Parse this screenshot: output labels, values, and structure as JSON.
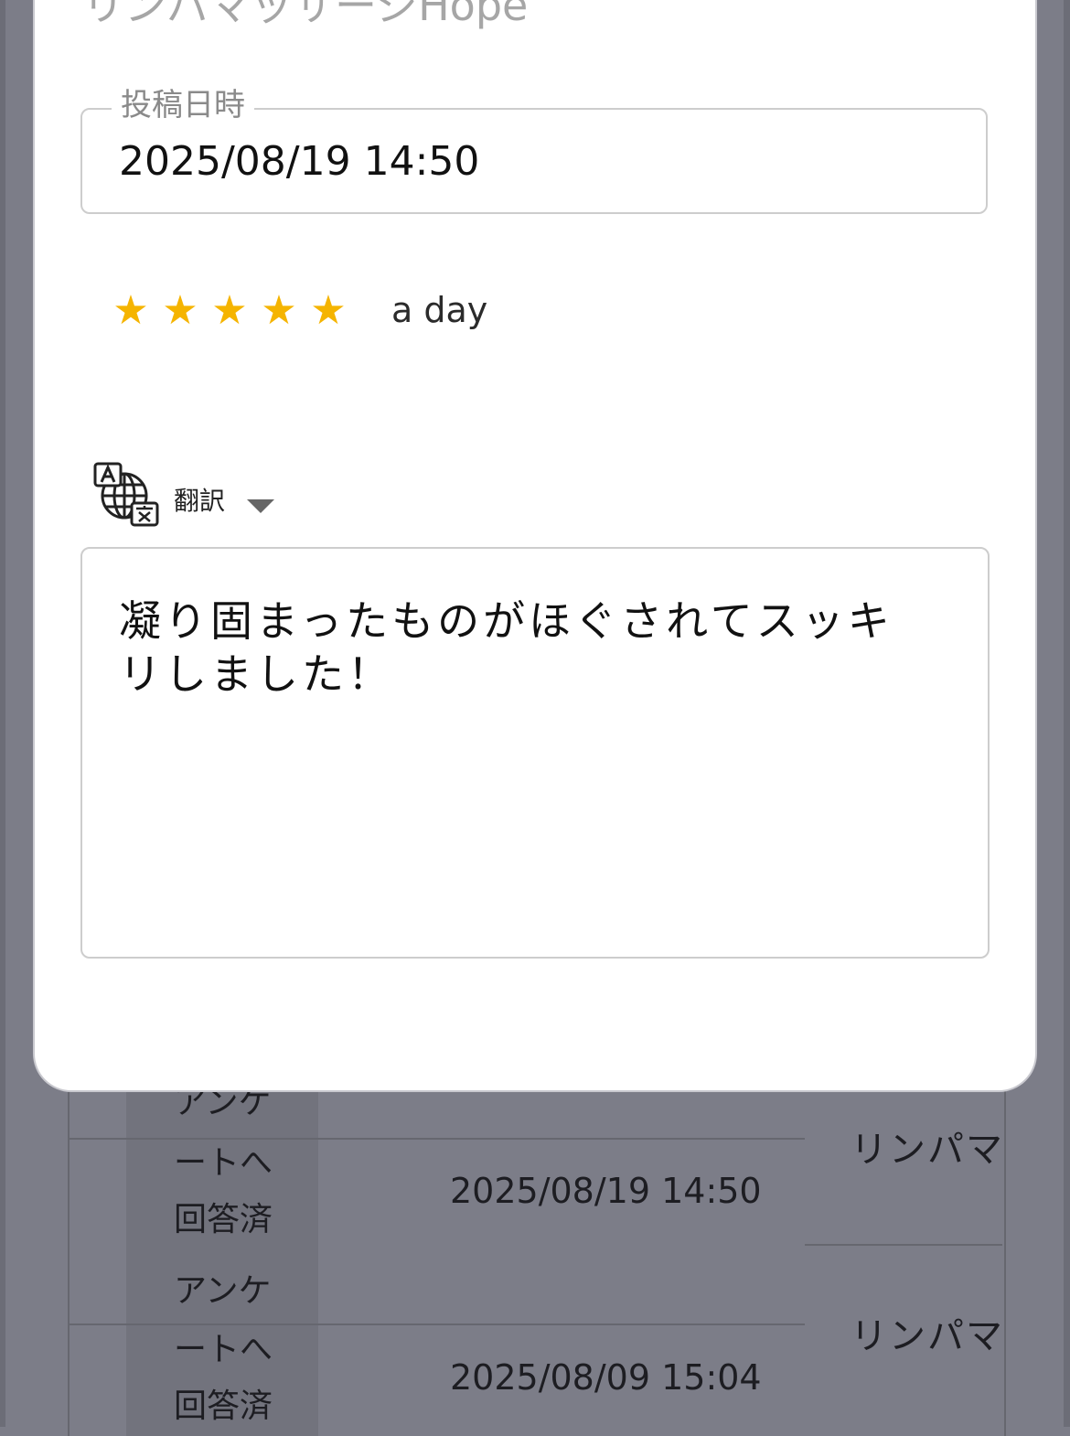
{
  "modal": {
    "shop_name": "リンパマッサージHope",
    "posted_label": "投稿日時",
    "posted_value": "2025/08/19 14:50",
    "rating": 5,
    "rating_time": "a day",
    "translate_label": "翻訳",
    "review_text": "凝り固まったものがほぐされてスッキリしました！",
    "star_color": "#f5b400"
  },
  "background": {
    "rows": [
      {
        "status": [
          "アンケ",
          "ートへ",
          "回答済"
        ],
        "date": "2025/08/19 14:50",
        "name": "リンパマ"
      },
      {
        "status": [
          "アンケ",
          "ートへ",
          "回答済"
        ],
        "date": "2025/08/09 15:04",
        "name": "リンパマ"
      }
    ]
  }
}
